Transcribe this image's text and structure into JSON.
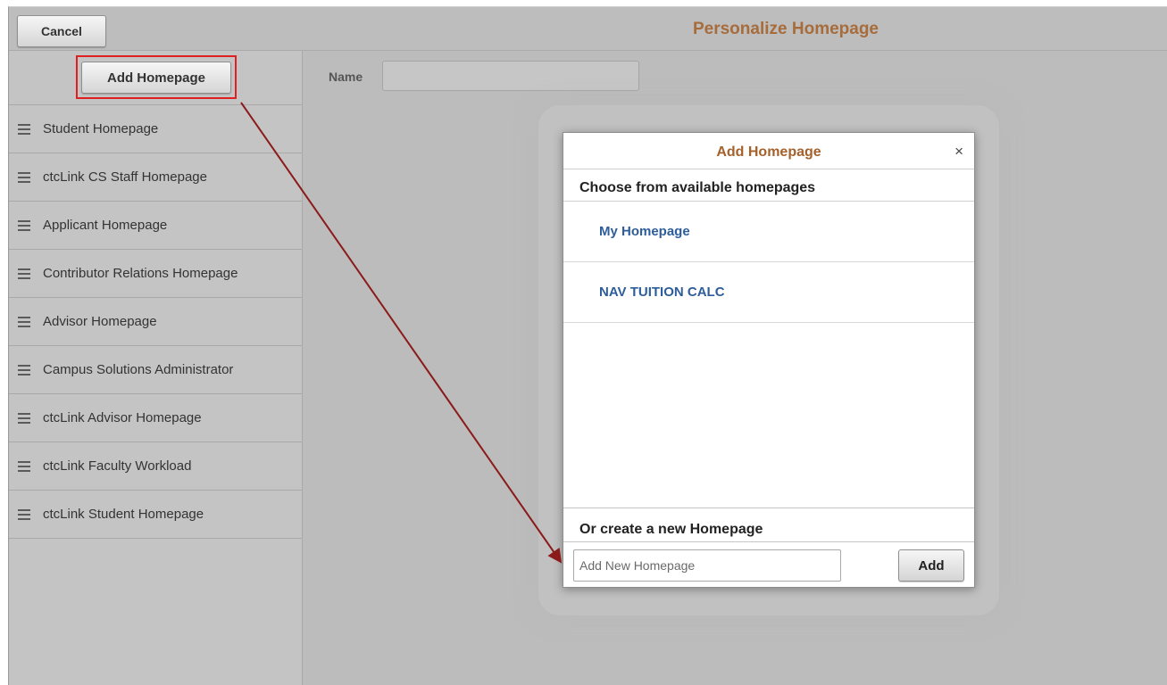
{
  "header": {
    "cancel_label": "Cancel",
    "title": "Personalize Homepage"
  },
  "sidebar": {
    "add_homepage_label": "Add Homepage",
    "items": [
      {
        "label": "Student Homepage"
      },
      {
        "label": "ctcLink CS Staff Homepage"
      },
      {
        "label": "Applicant Homepage"
      },
      {
        "label": "Contributor Relations Homepage"
      },
      {
        "label": "Advisor Homepage"
      },
      {
        "label": "Campus Solutions Administrator"
      },
      {
        "label": "ctcLink Advisor Homepage"
      },
      {
        "label": "ctcLink Faculty Workload"
      },
      {
        "label": "ctcLink Student Homepage"
      }
    ]
  },
  "main": {
    "name_label": "Name",
    "name_value": ""
  },
  "modal": {
    "title": "Add Homepage",
    "close_glyph": "×",
    "choose_label": "Choose from available homepages",
    "available": [
      {
        "label": "My Homepage"
      },
      {
        "label": "NAV TUITION CALC"
      }
    ],
    "create_label": "Or create a new Homepage",
    "new_placeholder": "Add New Homepage",
    "add_label": "Add"
  },
  "annotation": {
    "highlight_color": "#e02020",
    "arrow_color": "#8b1a1a"
  },
  "icons": {
    "drag_handle": "hamburger-icon",
    "close": "close-icon"
  }
}
